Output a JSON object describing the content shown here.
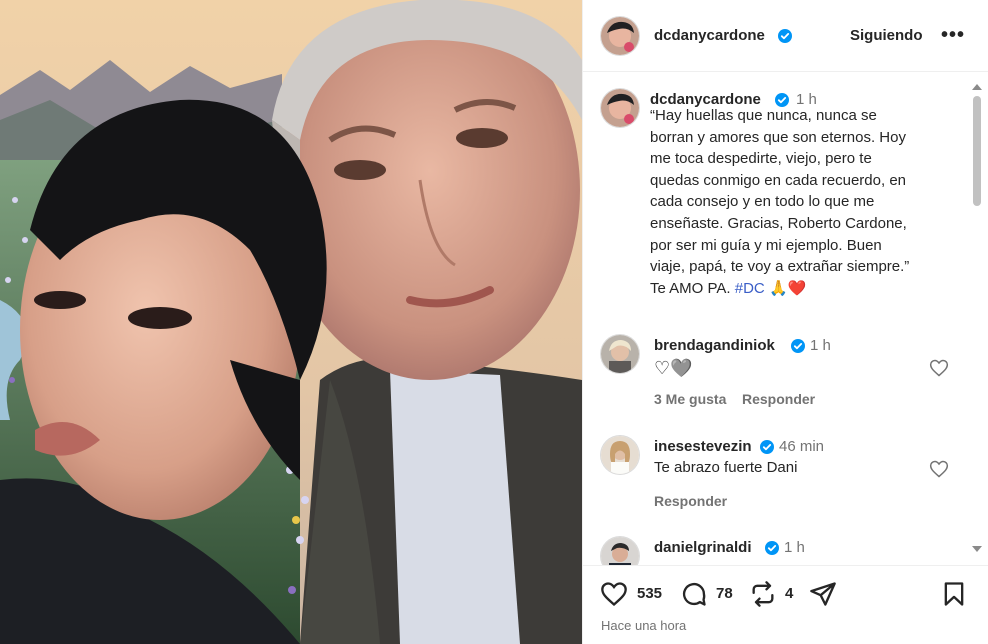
{
  "post": {
    "username": "dcdanycardone",
    "follow_label": "Siguiendo",
    "more_label": "•••",
    "caption_username": "dcdanycardone",
    "caption_time": "1 h",
    "caption_lines": [
      "“Hay huellas que nunca, nunca se",
      "borran y amores que son eternos. Hoy",
      "me toca despedirte, viejo, pero te",
      "quedas conmigo en cada recuerdo, en",
      "cada consejo y en todo lo que me",
      "enseñaste. Gracias, Roberto Cardone,",
      "por ser mi guía y mi ejemplo. Buen",
      "viaje, papá, te voy a extrañar siempre.”"
    ],
    "caption_last_prefix": "Te AMO PA. ",
    "caption_hashtag": "#DC",
    "caption_emoji": "🙏❤️"
  },
  "comments": [
    {
      "username": "brendagandiniok",
      "time": "1 h",
      "text": "♡🩶",
      "likes": "3 Me gusta",
      "reply": "Responder"
    },
    {
      "username": "inesestevezin",
      "time": "46 min",
      "text": "Te abrazo fuerte Dani",
      "reply": "Responder"
    },
    {
      "username": "danielgrinaldi",
      "time": "1 h"
    }
  ],
  "actions": {
    "likes": "535",
    "comments": "78",
    "shares": "4",
    "posted": "Hace una hora"
  },
  "colors": {
    "verified": "#0095f6",
    "hashtag": "#3a5ec7",
    "heart_emoji": "#e0245e"
  },
  "icons": [
    "verified-icon",
    "heart-icon",
    "comment-icon",
    "repost-icon",
    "share-icon",
    "bookmark-icon",
    "more-icon"
  ]
}
